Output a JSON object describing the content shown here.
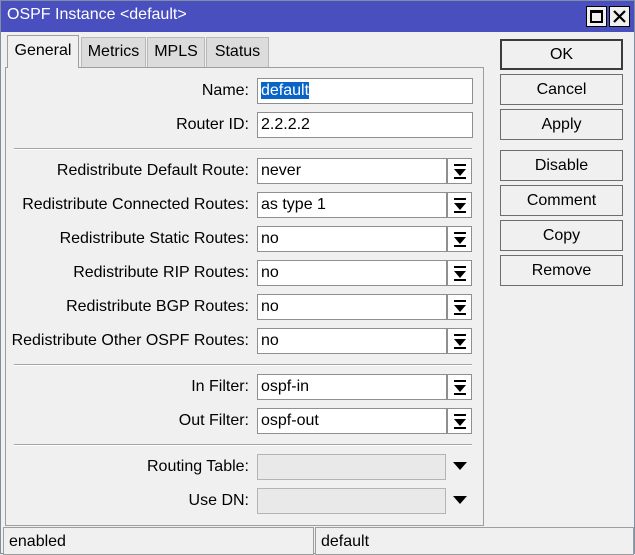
{
  "window": {
    "title": "OSPF Instance <default>",
    "titlebar_color": "#4a4fbf"
  },
  "tabs": [
    {
      "label": "General",
      "active": true
    },
    {
      "label": "Metrics",
      "active": false
    },
    {
      "label": "MPLS",
      "active": false
    },
    {
      "label": "Status",
      "active": false
    }
  ],
  "form": {
    "name": {
      "label": "Name:",
      "value": "default"
    },
    "router_id": {
      "label": "Router ID:",
      "value": "2.2.2.2"
    },
    "redistribute_default": {
      "label": "Redistribute Default Route:",
      "value": "never"
    },
    "redistribute_connected": {
      "label": "Redistribute Connected Routes:",
      "value": "as type 1"
    },
    "redistribute_static": {
      "label": "Redistribute Static Routes:",
      "value": "no"
    },
    "redistribute_rip": {
      "label": "Redistribute RIP Routes:",
      "value": "no"
    },
    "redistribute_bgp": {
      "label": "Redistribute BGP Routes:",
      "value": "no"
    },
    "redistribute_other_ospf": {
      "label": "Redistribute Other OSPF Routes:",
      "value": "no"
    },
    "in_filter": {
      "label": "In Filter:",
      "value": "ospf-in"
    },
    "out_filter": {
      "label": "Out Filter:",
      "value": "ospf-out"
    },
    "routing_table": {
      "label": "Routing Table:",
      "value": ""
    },
    "use_dn": {
      "label": "Use DN:",
      "value": ""
    }
  },
  "buttons": {
    "ok": "OK",
    "cancel": "Cancel",
    "apply": "Apply",
    "disable": "Disable",
    "comment": "Comment",
    "copy": "Copy",
    "remove": "Remove"
  },
  "status": {
    "left": "enabled",
    "right": "default"
  }
}
